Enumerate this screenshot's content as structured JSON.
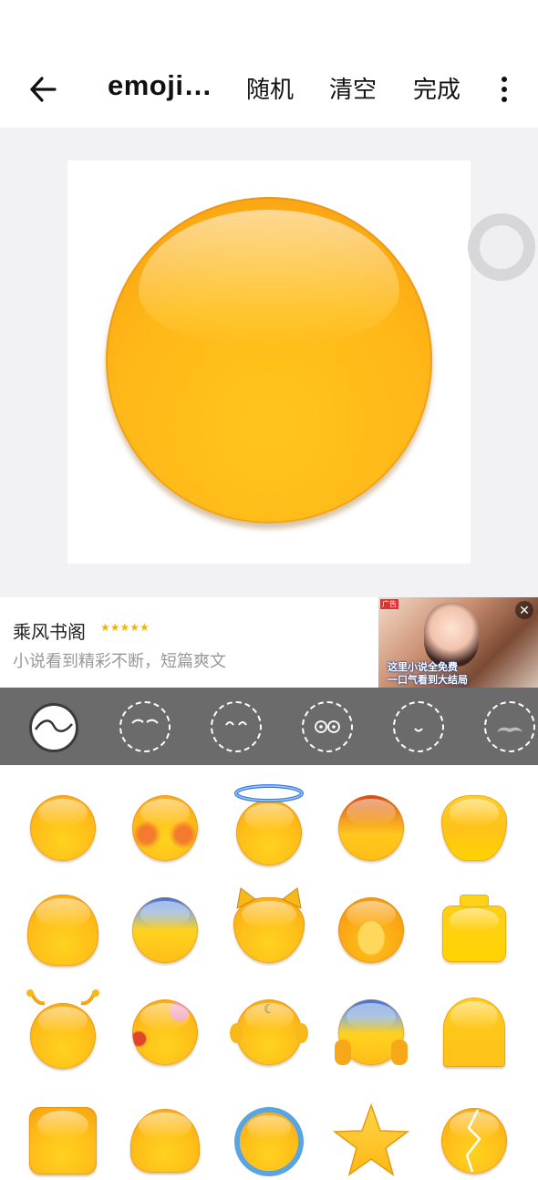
{
  "app_bar": {
    "title": "emoji…",
    "random_label": "随机",
    "clear_label": "清空",
    "done_label": "完成"
  },
  "ad": {
    "title": "乘风书阁",
    "stars": "★★★★★",
    "subtitle": "小说看到精彩不断，短篇爽文",
    "image_caption_line1": "这里小说全免费",
    "image_caption_line2": "一口气看到大结局",
    "image_badge": "广告"
  },
  "categories": [
    {
      "icon": "face-base-icon",
      "selected": true
    },
    {
      "icon": "eyebrows-icon",
      "selected": false
    },
    {
      "icon": "eyes-icon",
      "selected": false
    },
    {
      "icon": "glasses-icon",
      "selected": false
    },
    {
      "icon": "mouth-icon",
      "selected": false
    },
    {
      "icon": "mustache-icon",
      "selected": false
    }
  ],
  "face_options": [
    {
      "name": "plain-face"
    },
    {
      "name": "blush-face"
    },
    {
      "name": "halo-face"
    },
    {
      "name": "red-top-face"
    },
    {
      "name": "teardrop-face"
    },
    {
      "name": "wide-face"
    },
    {
      "name": "blue-top-face"
    },
    {
      "name": "cat-face"
    },
    {
      "name": "monkey-face"
    },
    {
      "name": "block-face"
    },
    {
      "name": "antenna-face"
    },
    {
      "name": "bandaged-face"
    },
    {
      "name": "eared-face"
    },
    {
      "name": "hands-face"
    },
    {
      "name": "arch-face"
    },
    {
      "name": "square-face"
    },
    {
      "name": "ghost-face"
    },
    {
      "name": "flower-face"
    },
    {
      "name": "star-face"
    },
    {
      "name": "cracked-face"
    }
  ],
  "colors": {
    "accent_yellow": "#ffbd18",
    "category_bar": "#6b6b6b",
    "preview_bg": "#f2f1f4"
  }
}
